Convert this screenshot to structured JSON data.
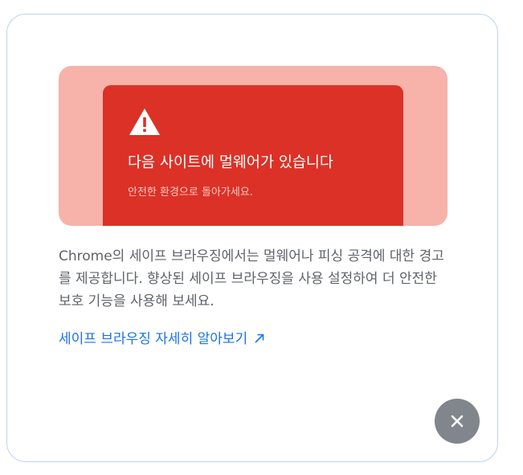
{
  "warning": {
    "heading": "다음 사이트에 멀웨어가 있습니다",
    "subtext": "안전한 환경으로 돌아가세요.",
    "icon": "warning-triangle-icon",
    "colors": {
      "background": "#f7b2aa",
      "panel": "#dc3126"
    }
  },
  "description": "Chrome의 세이프 브라우징에서는 멀웨어나 피싱 공격에 대한 경고를 제공합니다. 향상된 세이프 브라우징을 사용 설정하여 더 안전한 보호 기능을 사용해 보세요.",
  "learn_more": {
    "label": "세이프 브라우징 자세히 알아보기",
    "icon": "external-link-icon",
    "color": "#1a73e8"
  },
  "close": {
    "icon": "close-icon",
    "color": "#80868b"
  }
}
